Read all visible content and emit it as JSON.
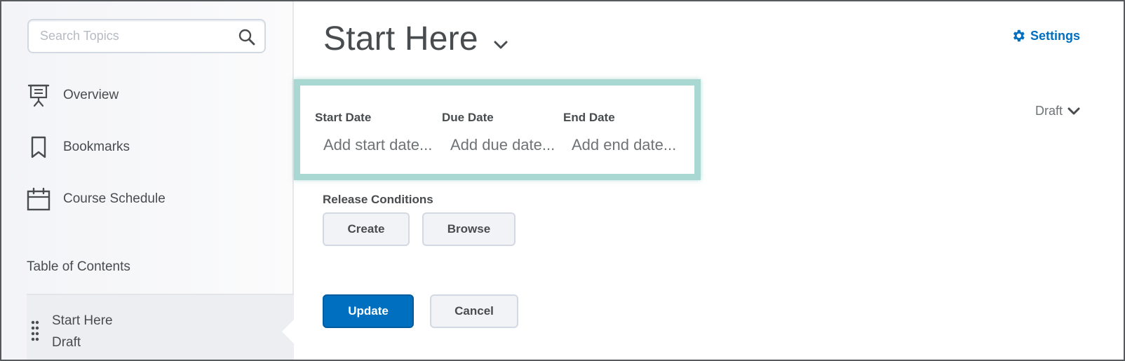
{
  "sidebar": {
    "search_placeholder": "Search Topics",
    "nav_items": [
      {
        "label": "Overview",
        "icon": "presentation-icon"
      },
      {
        "label": "Bookmarks",
        "icon": "bookmark-icon"
      },
      {
        "label": "Course Schedule",
        "icon": "calendar-icon"
      }
    ],
    "toc_heading": "Table of Contents",
    "toc_items": [
      {
        "title": "Start Here",
        "status": "Draft"
      }
    ]
  },
  "main": {
    "title": "Start Here",
    "settings_label": "Settings",
    "status_label": "Draft",
    "dates": [
      {
        "label": "Start Date",
        "placeholder": "Add start date..."
      },
      {
        "label": "Due Date",
        "placeholder": "Add due date..."
      },
      {
        "label": "End Date",
        "placeholder": "Add end date..."
      }
    ],
    "release_conditions_label": "Release Conditions",
    "create_label": "Create",
    "browse_label": "Browse",
    "update_label": "Update",
    "cancel_label": "Cancel"
  },
  "colors": {
    "accent": "#006fbf",
    "highlight": "#a9d8d2",
    "text": "#494c4e"
  }
}
